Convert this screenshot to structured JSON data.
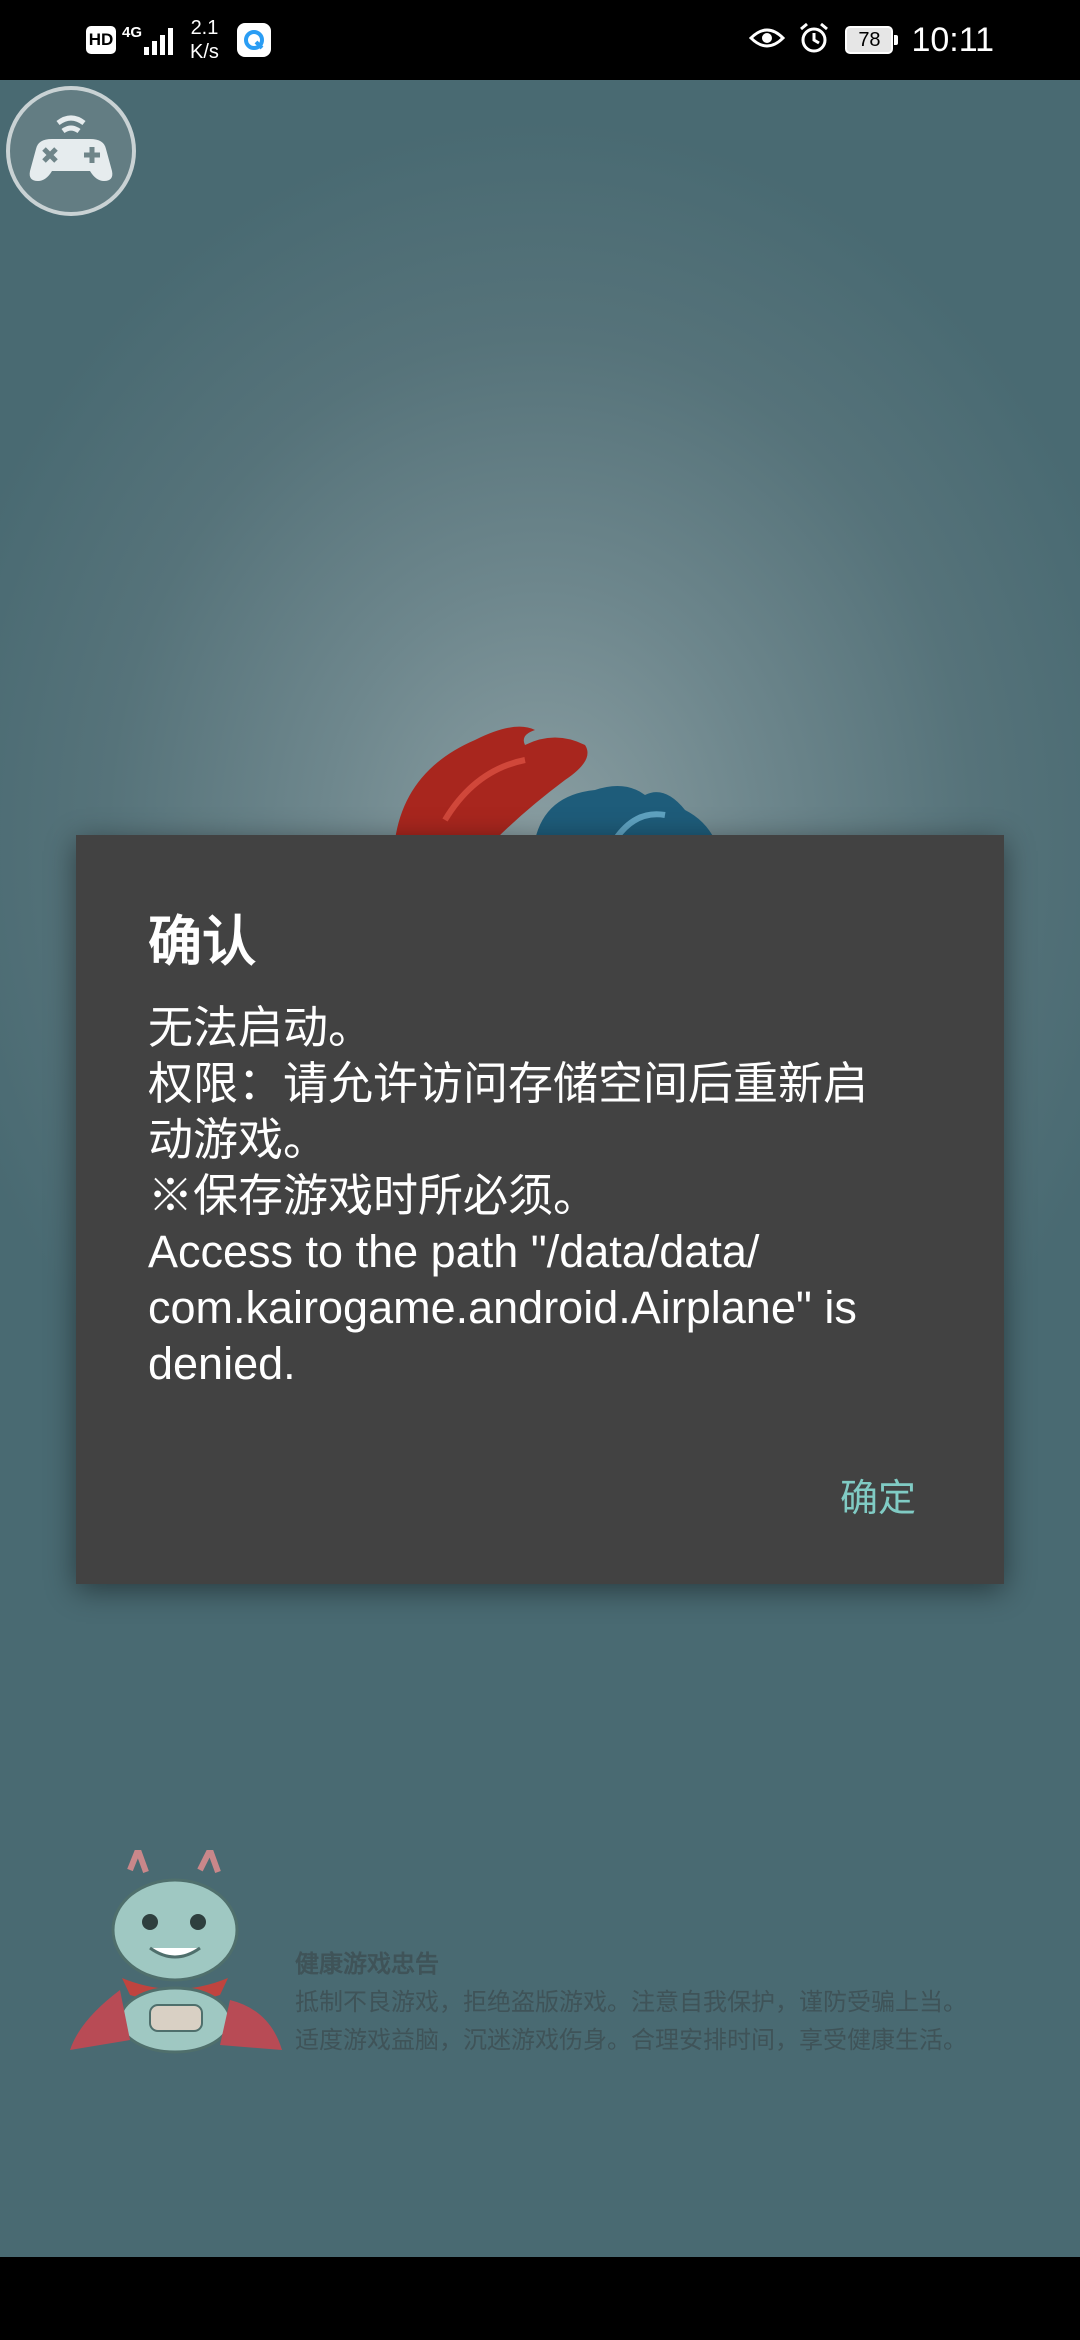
{
  "status_bar": {
    "hd_label": "HD",
    "network_label": "4G",
    "speed_value": "2.1",
    "speed_unit": "K/s",
    "battery": "78",
    "time": "10:11",
    "icons": [
      "hd-icon",
      "signal-icon",
      "app-notification-icon",
      "eye-icon",
      "alarm-icon",
      "battery-icon"
    ]
  },
  "dialog": {
    "title": "确认",
    "message_lines": [
      "无法启动。",
      "权限：请允许访问存储空间后重新启",
      "动游戏。",
      "※保存游戏时所必须。",
      "Access to the path \"/data/data/",
      "com.kairogame.android.Airplane\" is",
      "denied."
    ],
    "ok_label": "确定",
    "accent_color": "#80cbc4"
  },
  "notice": {
    "title": "健康游戏忠告",
    "line1": "抵制不良游戏，拒绝盗版游戏。注意自我保护，谨防受骗上当。",
    "line2": "适度游戏益脑，沉迷游戏伤身。合理安排时间，享受健康生活。"
  },
  "game": {
    "gamepad_icon": "gamepad-icon",
    "background_color": "#56737a"
  }
}
